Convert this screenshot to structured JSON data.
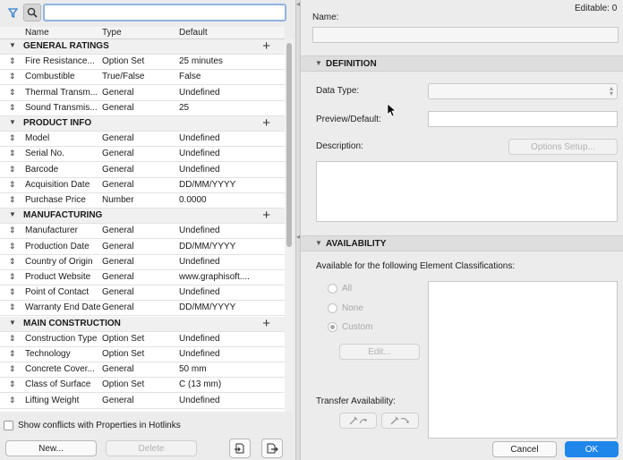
{
  "left_panel": {
    "search": {
      "value": "",
      "placeholder": ""
    },
    "columns": {
      "name": "Name",
      "type": "Type",
      "default": "Default"
    },
    "groups": [
      {
        "title": "GENERAL RATINGS",
        "items": [
          {
            "name": "Fire Resistance...",
            "type": "Option Set",
            "default": "25 minutes"
          },
          {
            "name": "Combustible",
            "type": "True/False",
            "default": "False"
          },
          {
            "name": "Thermal Transm...",
            "type": "General",
            "default": "Undefined"
          },
          {
            "name": "Sound Transmis...",
            "type": "General",
            "default": "25"
          }
        ]
      },
      {
        "title": "PRODUCT INFO",
        "items": [
          {
            "name": "Model",
            "type": "General",
            "default": "Undefined"
          },
          {
            "name": "Serial No.",
            "type": "General",
            "default": "Undefined"
          },
          {
            "name": "Barcode",
            "type": "General",
            "default": "Undefined"
          },
          {
            "name": "Acquisition Date",
            "type": "General",
            "default": "DD/MM/YYYY"
          },
          {
            "name": "Purchase Price",
            "type": "Number",
            "default": "0.0000"
          }
        ]
      },
      {
        "title": "MANUFACTURING",
        "items": [
          {
            "name": "Manufacturer",
            "type": "General",
            "default": "Undefined"
          },
          {
            "name": "Production Date",
            "type": "General",
            "default": "DD/MM/YYYY"
          },
          {
            "name": "Country of Origin",
            "type": "General",
            "default": "Undefined"
          },
          {
            "name": "Product Website",
            "type": "General",
            "default": "www.graphisoft...."
          },
          {
            "name": "Point of Contact",
            "type": "General",
            "default": "Undefined"
          },
          {
            "name": "Warranty End Date",
            "type": "General",
            "default": "DD/MM/YYYY"
          }
        ]
      },
      {
        "title": "MAIN CONSTRUCTION",
        "items": [
          {
            "name": "Construction Type",
            "type": "Option Set",
            "default": "Undefined"
          },
          {
            "name": "Technology",
            "type": "Option Set",
            "default": "Undefined"
          },
          {
            "name": "Concrete Cover...",
            "type": "General",
            "default": "50 mm"
          },
          {
            "name": "Class of Surface",
            "type": "Option Set",
            "default": "C (13 mm)"
          },
          {
            "name": "Lifting Weight",
            "type": "General",
            "default": "Undefined"
          }
        ]
      }
    ],
    "show_conflicts_label": "Show conflicts with Properties in Hotlinks",
    "new_label": "New...",
    "delete_label": "Delete"
  },
  "right_panel": {
    "editable_label": "Editable: 0",
    "name_label": "Name:",
    "name_value": "",
    "definition_title": "DEFINITION",
    "data_type_label": "Data Type:",
    "data_type_value": "",
    "preview_label": "Preview/Default:",
    "preview_value": "",
    "description_label": "Description:",
    "options_setup_label": "Options Setup...",
    "availability_title": "AVAILABILITY",
    "available_for_label": "Available for the following Element Classifications:",
    "radio_all": "All",
    "radio_none": "None",
    "radio_custom": "Custom",
    "edit_label": "Edit...",
    "transfer_label": "Transfer Availability:",
    "cancel_label": "Cancel",
    "ok_label": "OK"
  }
}
